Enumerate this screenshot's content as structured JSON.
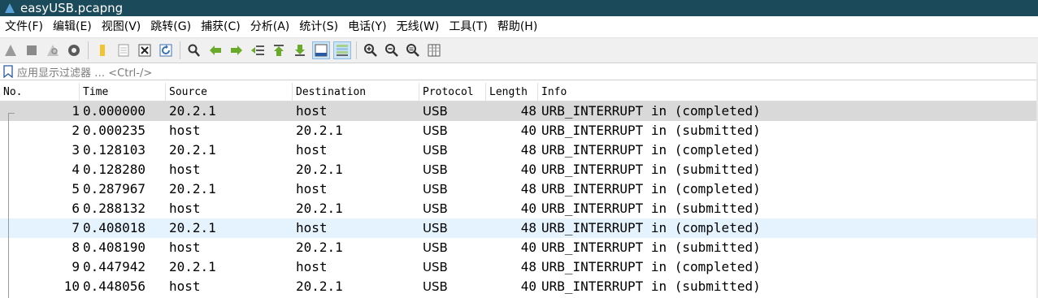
{
  "window": {
    "title": "easyUSB.pcapng"
  },
  "menu": [
    "文件(F)",
    "编辑(E)",
    "视图(V)",
    "跳转(G)",
    "捕获(C)",
    "分析(A)",
    "统计(S)",
    "电话(Y)",
    "无线(W)",
    "工具(T)",
    "帮助(H)"
  ],
  "filter": {
    "placeholder": "应用显示过滤器 … <Ctrl-/>"
  },
  "columns": {
    "no": "No.",
    "time": "Time",
    "source": "Source",
    "destination": "Destination",
    "protocol": "Protocol",
    "length": "Length",
    "info": "Info"
  },
  "packets": [
    {
      "no": "1",
      "time": "0.000000",
      "source": "20.2.1",
      "destination": "host",
      "protocol": "USB",
      "length": "48",
      "info": "URB_INTERRUPT in (completed)"
    },
    {
      "no": "2",
      "time": "0.000235",
      "source": "host",
      "destination": "20.2.1",
      "protocol": "USB",
      "length": "40",
      "info": "URB_INTERRUPT in (submitted)"
    },
    {
      "no": "3",
      "time": "0.128103",
      "source": "20.2.1",
      "destination": "host",
      "protocol": "USB",
      "length": "48",
      "info": "URB_INTERRUPT in (completed)"
    },
    {
      "no": "4",
      "time": "0.128280",
      "source": "host",
      "destination": "20.2.1",
      "protocol": "USB",
      "length": "40",
      "info": "URB_INTERRUPT in (submitted)"
    },
    {
      "no": "5",
      "time": "0.287967",
      "source": "20.2.1",
      "destination": "host",
      "protocol": "USB",
      "length": "48",
      "info": "URB_INTERRUPT in (completed)"
    },
    {
      "no": "6",
      "time": "0.288132",
      "source": "host",
      "destination": "20.2.1",
      "protocol": "USB",
      "length": "40",
      "info": "URB_INTERRUPT in (submitted)"
    },
    {
      "no": "7",
      "time": "0.408018",
      "source": "20.2.1",
      "destination": "host",
      "protocol": "USB",
      "length": "48",
      "info": "URB_INTERRUPT in (completed)"
    },
    {
      "no": "8",
      "time": "0.408190",
      "source": "host",
      "destination": "20.2.1",
      "protocol": "USB",
      "length": "40",
      "info": "URB_INTERRUPT in (submitted)"
    },
    {
      "no": "9",
      "time": "0.447942",
      "source": "20.2.1",
      "destination": "host",
      "protocol": "USB",
      "length": "48",
      "info": "URB_INTERRUPT in (completed)"
    },
    {
      "no": "10",
      "time": "0.448056",
      "source": "host",
      "destination": "20.2.1",
      "protocol": "USB",
      "length": "40",
      "info": "URB_INTERRUPT in (submitted)"
    }
  ],
  "state": {
    "selected_packet": "1",
    "hovered_packet": "7"
  },
  "toolbar_icons": [
    "start-capture-icon",
    "stop-capture-icon",
    "restart-capture-icon",
    "capture-options-icon",
    "open-file-icon",
    "save-file-icon",
    "close-file-icon",
    "reload-file-icon",
    "find-packet-icon",
    "go-back-icon",
    "go-forward-icon",
    "go-to-packet-icon",
    "go-first-packet-icon",
    "go-last-packet-icon",
    "autoscroll-icon",
    "colorize-icon",
    "zoom-in-icon",
    "zoom-out-icon",
    "normal-size-icon",
    "resize-columns-icon"
  ]
}
